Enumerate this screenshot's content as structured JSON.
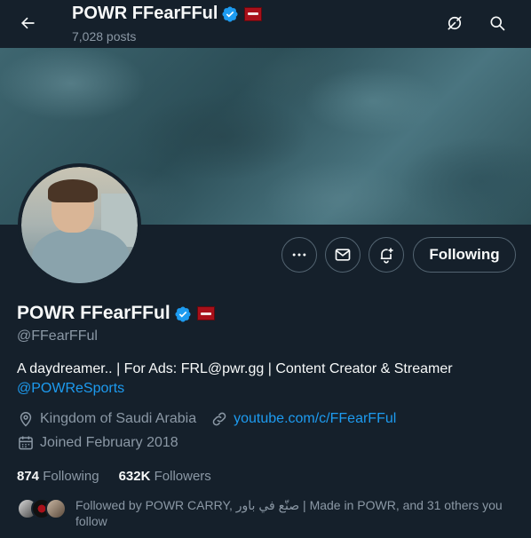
{
  "header": {
    "title": "POWR FFearFFul",
    "posts_count": "7,028 posts"
  },
  "profile": {
    "display_name": "POWR FFearFFul",
    "handle": "@FFearFFul",
    "bio_text": "A daydreamer.. | For Ads: FRL@pwr.gg | Content Creator & Streamer",
    "bio_mention": "@POWReSports",
    "location": "Kingdom of Saudi Arabia",
    "website": "youtube.com/c/FFearFFul",
    "joined": "Joined February 2018"
  },
  "actions": {
    "follow_label": "Following"
  },
  "stats": {
    "following_count": "874",
    "following_label": "Following",
    "followers_count": "632K",
    "followers_label": "Followers"
  },
  "followed_by": {
    "text": "Followed by POWR CARRY, صنّع في باور | Made in POWR, and 31 others you follow"
  },
  "icons": {
    "back": "arrow-left-icon",
    "grok": "grok-icon",
    "search": "search-icon",
    "more": "more-dots-icon",
    "message": "envelope-icon",
    "notify": "bell-plus-icon",
    "verified": "verified-badge-icon",
    "location": "location-pin-icon",
    "link": "link-icon",
    "calendar": "calendar-icon"
  },
  "colors": {
    "background": "#15202b",
    "accent": "#1d9bf0",
    "muted_text": "#8b98a5",
    "border": "#536471",
    "affiliate_flag": "#a8101a"
  }
}
